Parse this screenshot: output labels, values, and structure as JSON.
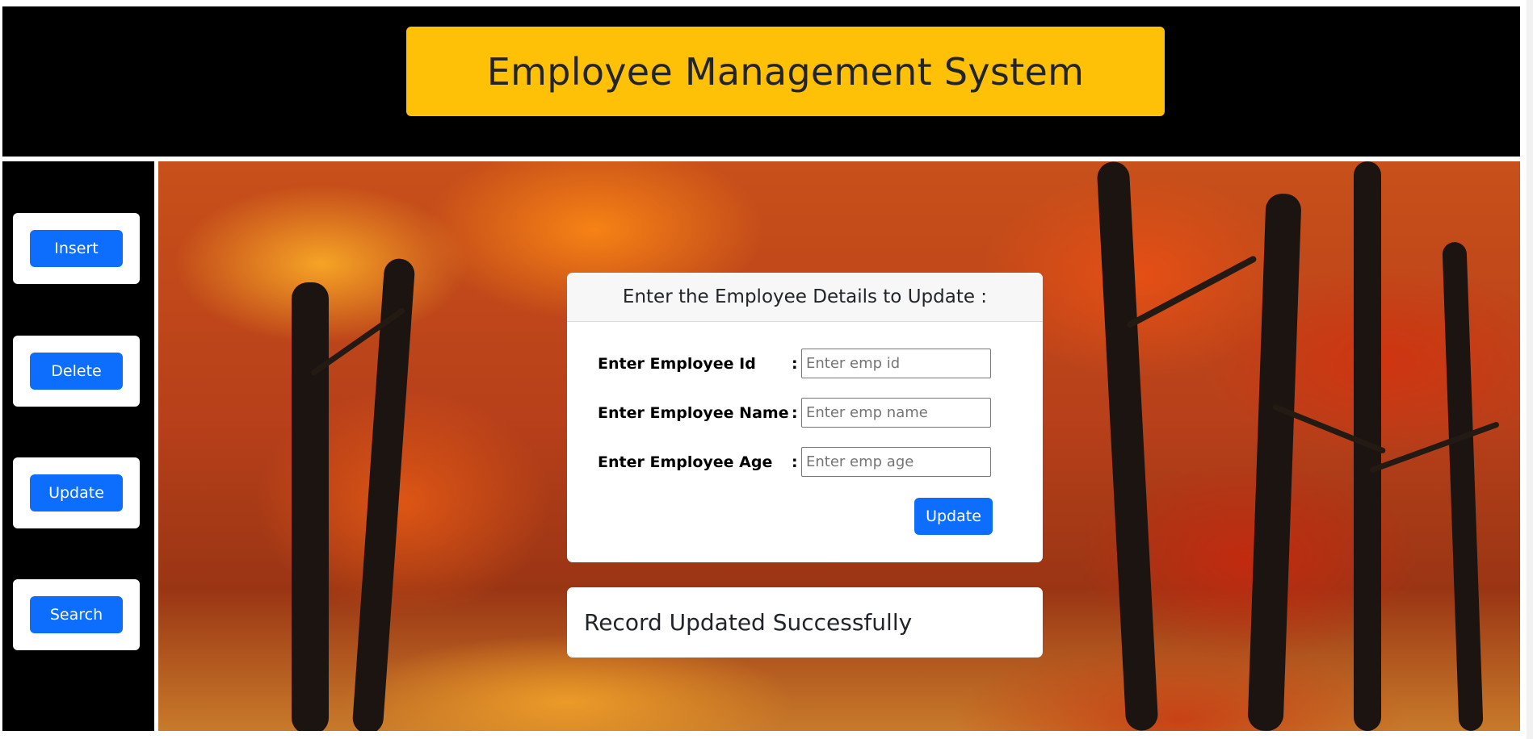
{
  "header": {
    "title": "Employee Management System"
  },
  "sidebar": {
    "items": [
      {
        "label": "Insert"
      },
      {
        "label": "Delete"
      },
      {
        "label": "Update"
      },
      {
        "label": "Search"
      }
    ]
  },
  "form": {
    "heading": "Enter the Employee Details to Update :",
    "fields": [
      {
        "label": "Enter Employee Id",
        "colon": ":",
        "placeholder": "Enter emp id",
        "value": ""
      },
      {
        "label": "Enter Employee Name",
        "colon": ":",
        "placeholder": "Enter emp name",
        "value": ""
      },
      {
        "label": "Enter Employee Age",
        "colon": ":",
        "placeholder": "Enter emp age",
        "value": ""
      }
    ],
    "submit_label": "Update"
  },
  "message": {
    "text": "Record Updated Successfully"
  },
  "colors": {
    "header_bg": "#000000",
    "title_bg": "#ffc107",
    "button_primary": "#0d6efd",
    "background_theme": "autumn-forest"
  }
}
